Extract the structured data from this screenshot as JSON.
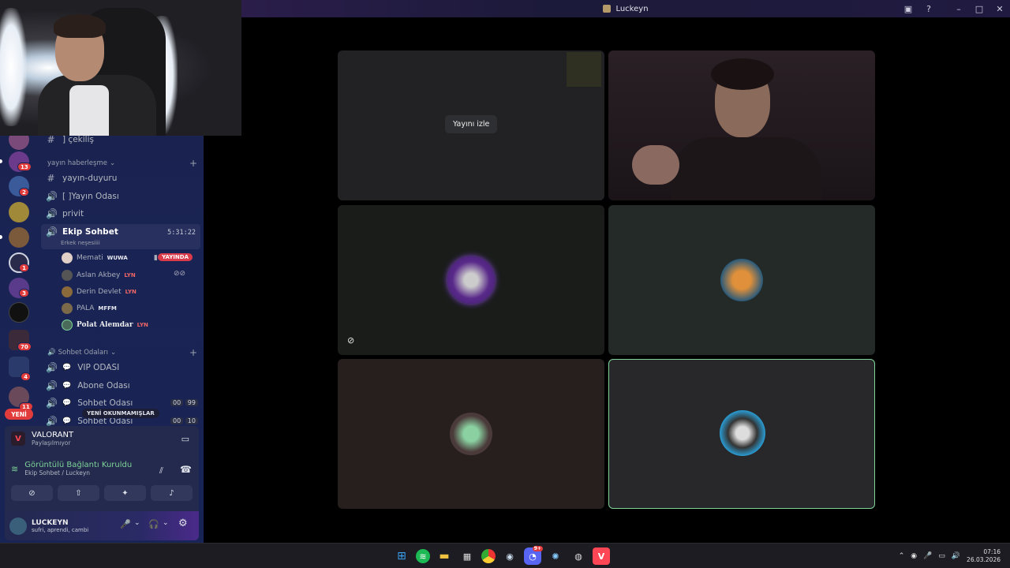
{
  "window": {
    "title": "Luckeyn"
  },
  "titlebar_icons": [
    "screen-share-icon",
    "help-icon",
    "minimize-icon",
    "maximize-icon",
    "close-icon"
  ],
  "servers": {
    "badges": [
      "13",
      "2",
      "1",
      "3",
      "70",
      "4",
      "11"
    ],
    "new_label": "YENİ"
  },
  "channels": {
    "cekilis": "] çekiliş",
    "cat_stream": "yayın haberleşme",
    "yayin_duyuru": "yayın-duyuru",
    "yayin_odasi": "[ ]Yayın Odası",
    "privit": "privit",
    "ekip": "Ekip Sohbet",
    "ekip_timer": "5:31:22",
    "ekip_status": "Erkek neşesiiii",
    "cat_chat": "Sohbet Odaları",
    "vip": "VIP ODASI",
    "abone": "Abone Odası",
    "sohbet1": "Sohbet Odası",
    "sohbet1_cnt": [
      "00",
      "99"
    ],
    "sohbet2": "Sohbet Odası",
    "sohbet2_cnt": [
      "00",
      "10"
    ],
    "unread": "YENİ OKUNMAMIŞLAR"
  },
  "voice_users": [
    {
      "name": "Memati",
      "tag": "WUWA"
    },
    {
      "name": "Aslan Akbey",
      "tag": "LYN"
    },
    {
      "name": "Derin Devlet",
      "tag": "LYN"
    },
    {
      "name": "PALA",
      "tag": "MFFM"
    },
    {
      "name": "Polat Alemdar",
      "tag": "LYN"
    }
  ],
  "live_label": "YAYINDA",
  "activity": {
    "game": "VALORANT",
    "sub": "Paylaşılmıyor"
  },
  "connection": {
    "status": "Görüntülü Bağlantı Kuruldu",
    "channel": "Ekip Sohbet / Luckeyn"
  },
  "user": {
    "name": "LUCKEYN",
    "status": "sufri, aprendi, cambi"
  },
  "video": {
    "watch_label": "Yayını izle"
  },
  "clock": {
    "time": "07:16",
    "date": "26.03.2026"
  },
  "taskbar": {
    "discord_badge": "9+"
  }
}
